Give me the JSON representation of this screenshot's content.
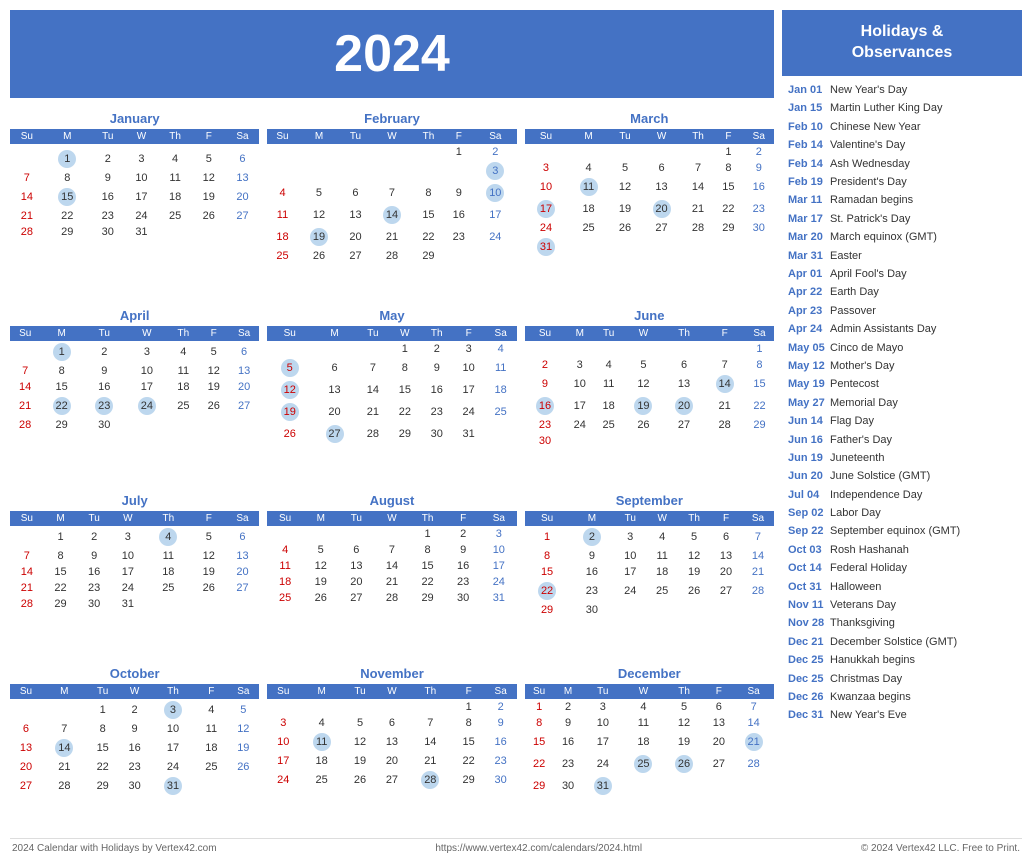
{
  "year": "2024",
  "title": "2024",
  "holidays_header": "Holidays &\nObservances",
  "footer_left": "2024 Calendar with Holidays by Vertex42.com",
  "footer_center": "https://www.vertex42.com/calendars/2024.html",
  "footer_right": "© 2024 Vertex42 LLC. Free to Print.",
  "day_headers": [
    "Su",
    "M",
    "Tu",
    "W",
    "Th",
    "F",
    "Sa"
  ],
  "months": [
    {
      "name": "January",
      "weeks": [
        [
          "",
          "",
          "",
          "",
          "",
          "",
          ""
        ],
        [
          "",
          "1h",
          "2",
          "3",
          "4",
          "5",
          "6"
        ],
        [
          "7",
          "8",
          "9",
          "10",
          "11",
          "12",
          "13"
        ],
        [
          "14",
          "15h",
          "16",
          "17",
          "18",
          "19",
          "20"
        ],
        [
          "21",
          "22",
          "23",
          "24",
          "25",
          "26",
          "27"
        ],
        [
          "28",
          "29",
          "30",
          "31",
          "",
          "",
          ""
        ]
      ]
    },
    {
      "name": "February",
      "weeks": [
        [
          "",
          "",
          "",
          "",
          "",
          "1",
          "2"
        ],
        [
          "",
          "",
          "",
          "",
          "",
          "",
          "3h"
        ],
        [
          "4",
          "5",
          "6",
          "7",
          "8",
          "9",
          "10h"
        ],
        [
          "11",
          "12",
          "13",
          "14h",
          "15",
          "16",
          "17"
        ],
        [
          "18",
          "19h",
          "20",
          "21",
          "22",
          "23",
          "24"
        ],
        [
          "25",
          "26",
          "27",
          "28",
          "29",
          "",
          ""
        ]
      ]
    },
    {
      "name": "March",
      "weeks": [
        [
          "",
          "",
          "",
          "",
          "",
          "1",
          "2"
        ],
        [
          "3",
          "4",
          "5",
          "6",
          "7",
          "8",
          "9"
        ],
        [
          "10",
          "11h",
          "12",
          "13",
          "14",
          "15",
          "16"
        ],
        [
          "17h",
          "18",
          "19",
          "20h",
          "21",
          "22",
          "23"
        ],
        [
          "24",
          "25",
          "26",
          "27",
          "28",
          "29",
          "30"
        ],
        [
          "31h",
          "",
          "",
          "",
          "",
          "",
          ""
        ]
      ]
    },
    {
      "name": "April",
      "weeks": [
        [
          "",
          "1h",
          "2",
          "3",
          "4",
          "5",
          "6"
        ],
        [
          "7",
          "8",
          "9",
          "10",
          "11",
          "12",
          "13"
        ],
        [
          "14",
          "15",
          "16",
          "17",
          "18",
          "19",
          "20"
        ],
        [
          "21",
          "22h",
          "23h",
          "24h",
          "25",
          "26",
          "27"
        ],
        [
          "28",
          "29",
          "30",
          "",
          "",
          "",
          ""
        ],
        [
          "",
          "",
          "",
          "",
          "",
          "",
          ""
        ]
      ]
    },
    {
      "name": "May",
      "weeks": [
        [
          "",
          "",
          "",
          "1",
          "2",
          "3",
          "4"
        ],
        [
          "5h",
          "6",
          "7",
          "8",
          "9",
          "10",
          "11"
        ],
        [
          "12h",
          "13",
          "14",
          "15",
          "16",
          "17",
          "18"
        ],
        [
          "19h",
          "20",
          "21",
          "22",
          "23",
          "24",
          "25"
        ],
        [
          "26",
          "27h",
          "28",
          "29",
          "30",
          "31",
          ""
        ],
        [
          "",
          "",
          "",
          "",
          "",
          "",
          ""
        ]
      ]
    },
    {
      "name": "June",
      "weeks": [
        [
          "",
          "",
          "",
          "",
          "",
          "",
          "1"
        ],
        [
          "2",
          "3",
          "4",
          "5",
          "6",
          "7",
          "8"
        ],
        [
          "9",
          "10",
          "11",
          "12",
          "13",
          "14h",
          "15"
        ],
        [
          "16h",
          "17",
          "18",
          "19h",
          "20h",
          "21",
          "22"
        ],
        [
          "23",
          "24",
          "25",
          "26",
          "27",
          "28",
          "29"
        ],
        [
          "30",
          "",
          "",
          "",
          "",
          "",
          ""
        ]
      ]
    },
    {
      "name": "July",
      "weeks": [
        [
          "",
          "1",
          "2",
          "3",
          "4h",
          "5",
          "6"
        ],
        [
          "7",
          "8",
          "9",
          "10",
          "11",
          "12",
          "13"
        ],
        [
          "14",
          "15",
          "16",
          "17",
          "18",
          "19",
          "20"
        ],
        [
          "21",
          "22",
          "23",
          "24",
          "25",
          "26",
          "27"
        ],
        [
          "28",
          "29",
          "30",
          "31",
          "",
          "",
          ""
        ],
        [
          "",
          "",
          "",
          "",
          "",
          "",
          ""
        ]
      ]
    },
    {
      "name": "August",
      "weeks": [
        [
          "",
          "",
          "",
          "",
          "1",
          "2",
          "3"
        ],
        [
          "4",
          "5",
          "6",
          "7",
          "8",
          "9",
          "10"
        ],
        [
          "11",
          "12",
          "13",
          "14",
          "15",
          "16",
          "17"
        ],
        [
          "18",
          "19",
          "20",
          "21",
          "22",
          "23",
          "24"
        ],
        [
          "25",
          "26",
          "27",
          "28",
          "29",
          "30",
          "31"
        ],
        [
          "",
          "",
          "",
          "",
          "",
          "",
          ""
        ]
      ]
    },
    {
      "name": "September",
      "weeks": [
        [
          "1",
          "2h",
          "3",
          "4",
          "5",
          "6",
          "7"
        ],
        [
          "8",
          "9",
          "10",
          "11",
          "12",
          "13",
          "14"
        ],
        [
          "15",
          "16",
          "17",
          "18",
          "19",
          "20",
          "21"
        ],
        [
          "22h",
          "23",
          "24",
          "25",
          "26",
          "27",
          "28"
        ],
        [
          "29",
          "30",
          "",
          "",
          "",
          "",
          ""
        ],
        [
          "",
          "",
          "",
          "",
          "",
          "",
          ""
        ]
      ]
    },
    {
      "name": "October",
      "weeks": [
        [
          "",
          "",
          "1",
          "2",
          "3h",
          "4",
          "5"
        ],
        [
          "6",
          "7",
          "8",
          "9",
          "10",
          "11",
          "12"
        ],
        [
          "13",
          "14h",
          "15",
          "16",
          "17",
          "18",
          "19"
        ],
        [
          "20",
          "21",
          "22",
          "23",
          "24",
          "25",
          "26"
        ],
        [
          "27",
          "28",
          "29",
          "30",
          "31h",
          "",
          ""
        ],
        [
          "",
          "",
          "",
          "",
          "",
          "",
          ""
        ]
      ]
    },
    {
      "name": "November",
      "weeks": [
        [
          "",
          "",
          "",
          "",
          "",
          "1",
          "2"
        ],
        [
          "3",
          "4",
          "5",
          "6",
          "7",
          "8",
          "9"
        ],
        [
          "10",
          "11h",
          "12",
          "13",
          "14",
          "15",
          "16"
        ],
        [
          "17",
          "18",
          "19",
          "20",
          "21",
          "22",
          "23"
        ],
        [
          "24",
          "25",
          "26",
          "27",
          "28h",
          "29",
          "30"
        ],
        [
          "",
          "",
          "",
          "",
          "",
          "",
          ""
        ]
      ]
    },
    {
      "name": "December",
      "weeks": [
        [
          "1",
          "2",
          "3",
          "4",
          "5",
          "6",
          "7"
        ],
        [
          "8",
          "9",
          "10",
          "11",
          "12",
          "13",
          "14"
        ],
        [
          "15",
          "16",
          "17",
          "18",
          "19",
          "20",
          "21h"
        ],
        [
          "22",
          "23",
          "24",
          "25h",
          "26h",
          "27",
          "28"
        ],
        [
          "29",
          "30",
          "31h",
          "",
          "",
          "",
          ""
        ],
        [
          "",
          "",
          "",
          "",
          "",
          "",
          ""
        ]
      ]
    }
  ],
  "holidays": [
    {
      "date": "Jan 01",
      "name": "New Year's Day"
    },
    {
      "date": "Jan 15",
      "name": "Martin Luther King Day"
    },
    {
      "date": "Feb 10",
      "name": "Chinese New Year"
    },
    {
      "date": "Feb 14",
      "name": "Valentine's Day"
    },
    {
      "date": "Feb 14",
      "name": "Ash Wednesday"
    },
    {
      "date": "Feb 19",
      "name": "President's Day"
    },
    {
      "date": "Mar 11",
      "name": "Ramadan begins"
    },
    {
      "date": "Mar 17",
      "name": "St. Patrick's Day"
    },
    {
      "date": "Mar 20",
      "name": "March equinox (GMT)"
    },
    {
      "date": "Mar 31",
      "name": "Easter"
    },
    {
      "date": "Apr 01",
      "name": "April Fool's Day"
    },
    {
      "date": "Apr 22",
      "name": "Earth Day"
    },
    {
      "date": "Apr 23",
      "name": "Passover"
    },
    {
      "date": "Apr 24",
      "name": "Admin Assistants Day"
    },
    {
      "date": "May 05",
      "name": "Cinco de Mayo"
    },
    {
      "date": "May 12",
      "name": "Mother's Day"
    },
    {
      "date": "May 19",
      "name": "Pentecost"
    },
    {
      "date": "May 27",
      "name": "Memorial Day"
    },
    {
      "date": "Jun 14",
      "name": "Flag Day"
    },
    {
      "date": "Jun 16",
      "name": "Father's Day"
    },
    {
      "date": "Jun 19",
      "name": "Juneteenth"
    },
    {
      "date": "Jun 20",
      "name": "June Solstice (GMT)"
    },
    {
      "date": "Jul 04",
      "name": "Independence Day"
    },
    {
      "date": "Sep 02",
      "name": "Labor Day"
    },
    {
      "date": "Sep 22",
      "name": "September equinox (GMT)"
    },
    {
      "date": "Oct 03",
      "name": "Rosh Hashanah"
    },
    {
      "date": "Oct 14",
      "name": "Federal Holiday"
    },
    {
      "date": "Oct 31",
      "name": "Halloween"
    },
    {
      "date": "Nov 11",
      "name": "Veterans Day"
    },
    {
      "date": "Nov 28",
      "name": "Thanksgiving"
    },
    {
      "date": "Dec 21",
      "name": "December Solstice (GMT)"
    },
    {
      "date": "Dec 25",
      "name": "Hanukkah begins"
    },
    {
      "date": "Dec 25",
      "name": "Christmas Day"
    },
    {
      "date": "Dec 26",
      "name": "Kwanzaa begins"
    },
    {
      "date": "Dec 31",
      "name": "New Year's Eve"
    }
  ]
}
